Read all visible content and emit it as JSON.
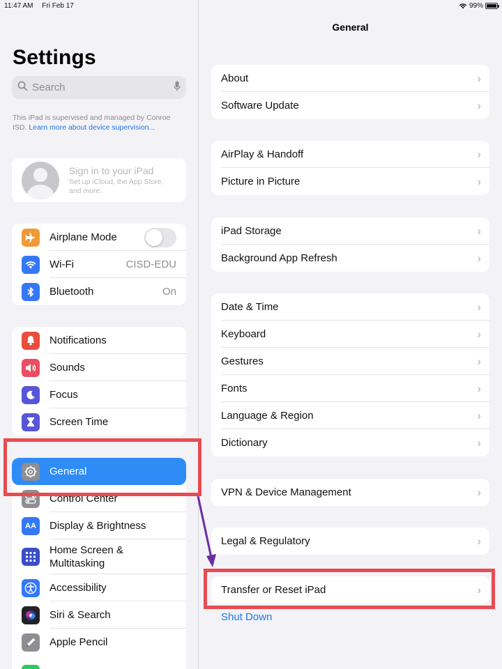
{
  "status_bar": {
    "time": "11:47 AM",
    "date": "Fri Feb 17",
    "battery": "99%",
    "battery_level": 0.99
  },
  "sidebar": {
    "title": "Settings",
    "search_placeholder": "Search",
    "supervision_text": "This iPad is supervised and managed by Conroe ISD.",
    "supervision_link": "Learn more about device supervision...",
    "profile": {
      "title": "Sign in to your iPad",
      "subtitle": "Set up iCloud, the App Store, and more."
    },
    "group1": [
      {
        "label": "Airplane Mode",
        "icon": "airplane-icon",
        "color": "#f09a37",
        "toggle_on": false
      },
      {
        "label": "Wi-Fi",
        "icon": "wifi-icon",
        "color": "#3478f6",
        "value": "CISD-EDU"
      },
      {
        "label": "Bluetooth",
        "icon": "bluetooth-icon",
        "color": "#3478f6",
        "value": "On"
      }
    ],
    "group2": [
      {
        "label": "Notifications",
        "icon": "bell-icon",
        "color": "#eb4d3d"
      },
      {
        "label": "Sounds",
        "icon": "speaker-icon",
        "color": "#eb4d62"
      },
      {
        "label": "Focus",
        "icon": "moon-icon",
        "color": "#5856d6"
      },
      {
        "label": "Screen Time",
        "icon": "hourglass-icon",
        "color": "#5856d6"
      }
    ],
    "group3": [
      {
        "label": "General",
        "icon": "gear-icon",
        "color": "#8e8e93",
        "selected": true
      },
      {
        "label": "Control Center",
        "icon": "switches-icon",
        "color": "#8e8e93"
      },
      {
        "label": "Display & Brightness",
        "icon": "text-size-icon",
        "color": "#3478f6",
        "glyph": "AA"
      },
      {
        "label": "Home Screen & Multitasking",
        "icon": "grid-icon",
        "color": "#3a4ec8"
      },
      {
        "label": "Accessibility",
        "icon": "accessibility-icon",
        "color": "#3478f6"
      },
      {
        "label": "Siri & Search",
        "icon": "siri-icon",
        "color": "#222222"
      },
      {
        "label": "Apple Pencil",
        "icon": "pencil-icon",
        "color": "#8e8e93"
      }
    ]
  },
  "main": {
    "title": "General",
    "groups": [
      [
        "About",
        "Software Update"
      ],
      [
        "AirPlay & Handoff",
        "Picture in Picture"
      ],
      [
        "iPad Storage",
        "Background App Refresh"
      ],
      [
        "Date & Time",
        "Keyboard",
        "Gestures",
        "Fonts",
        "Language & Region",
        "Dictionary"
      ],
      [
        "VPN & Device Management"
      ],
      [
        "Legal & Regulatory"
      ],
      [
        "Transfer or Reset iPad"
      ]
    ],
    "shut_down": "Shut Down"
  },
  "annotation_colors": {
    "box": "#e74c50",
    "arrow": "#6a2ea0"
  }
}
